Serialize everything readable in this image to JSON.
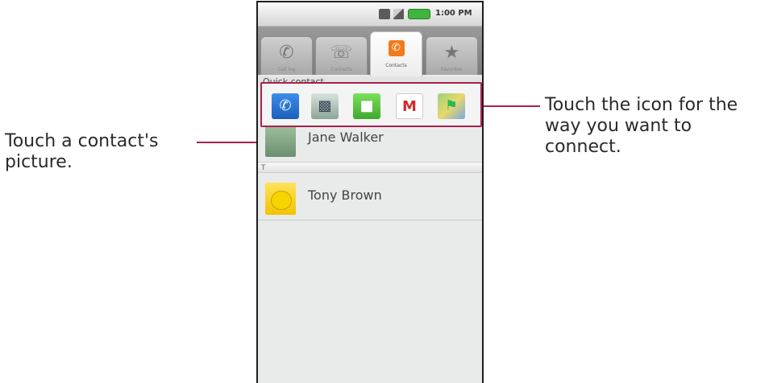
{
  "callouts": {
    "left": "Touch a contact's picture.",
    "right": "Touch the icon for the way you want to connect."
  },
  "status_bar": {
    "time": "1:00 PM"
  },
  "tabs": [
    {
      "label": "Call log",
      "icon": "phone-icon"
    },
    {
      "label": "Contacts",
      "icon": "contacts-icon"
    },
    {
      "label": "Contacts",
      "icon": "dialer-icon",
      "active": true
    },
    {
      "label": "Favorites",
      "icon": "star-icon"
    }
  ],
  "contacts": {
    "section_header": "Quick contact",
    "divider_letter": "T",
    "rows": [
      {
        "name": "Jane Walker"
      },
      {
        "name": "Tony Brown"
      }
    ]
  },
  "quick_contact_actions": [
    {
      "name": "call",
      "icon": "phone-icon"
    },
    {
      "name": "contact-card",
      "icon": "contact-card-icon"
    },
    {
      "name": "sms",
      "icon": "chat-bubble-icon"
    },
    {
      "name": "gmail",
      "icon": "gmail-icon",
      "glyph": "M"
    },
    {
      "name": "map",
      "icon": "map-icon"
    }
  ],
  "colors": {
    "leader_line": "#a8224e",
    "dialer_tab_accent": "#f27a1b"
  }
}
